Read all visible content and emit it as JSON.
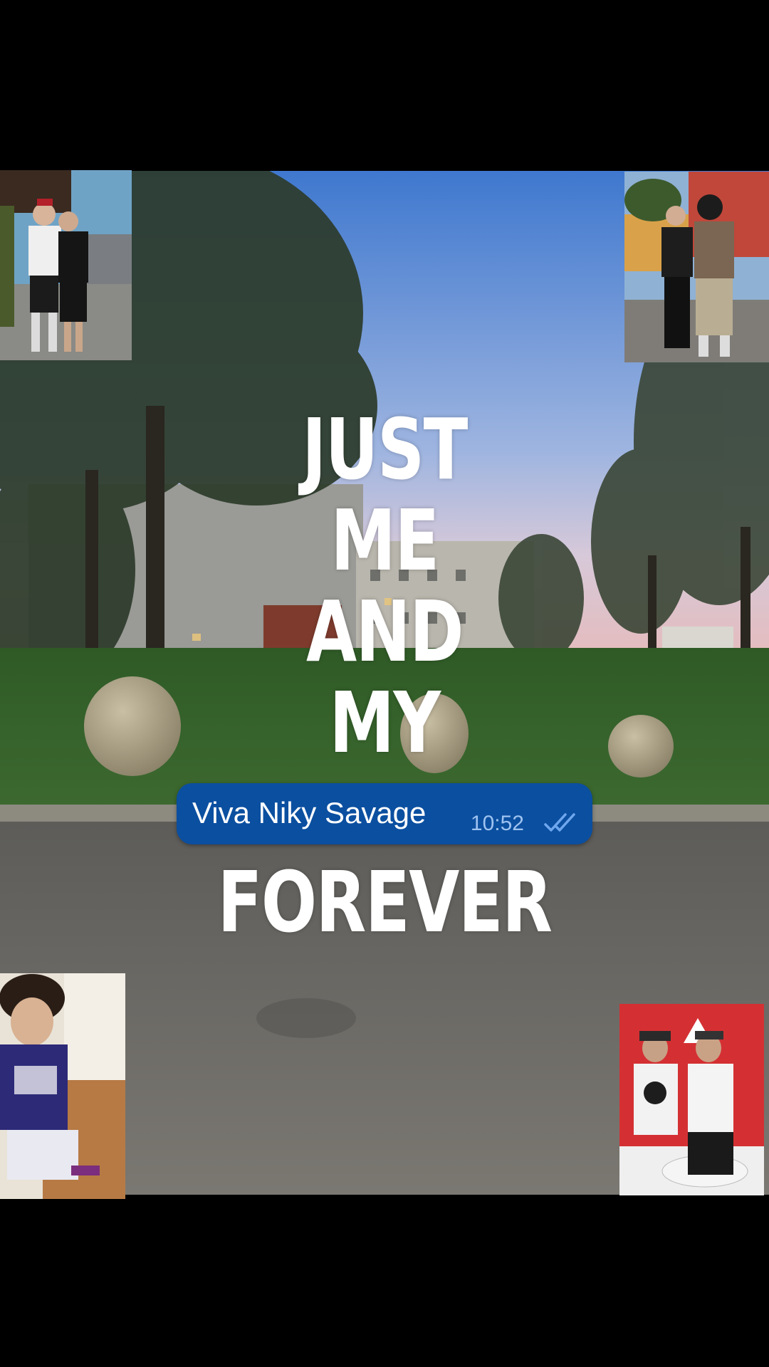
{
  "headline": {
    "line1": "JUST",
    "line2": "ME",
    "line3": "AND",
    "line4": "MY",
    "line5": "FOREVER"
  },
  "message": {
    "text": "Viva Niky Savage",
    "time": "10:52",
    "status_icon": "double-check-icon",
    "bubble_color": "#0b4fa0"
  },
  "colors": {
    "sky_top": "#4f86d4",
    "sky_bottom": "#c6cfe3",
    "grass": "#3b6b2c",
    "road": "#6f6d68"
  }
}
